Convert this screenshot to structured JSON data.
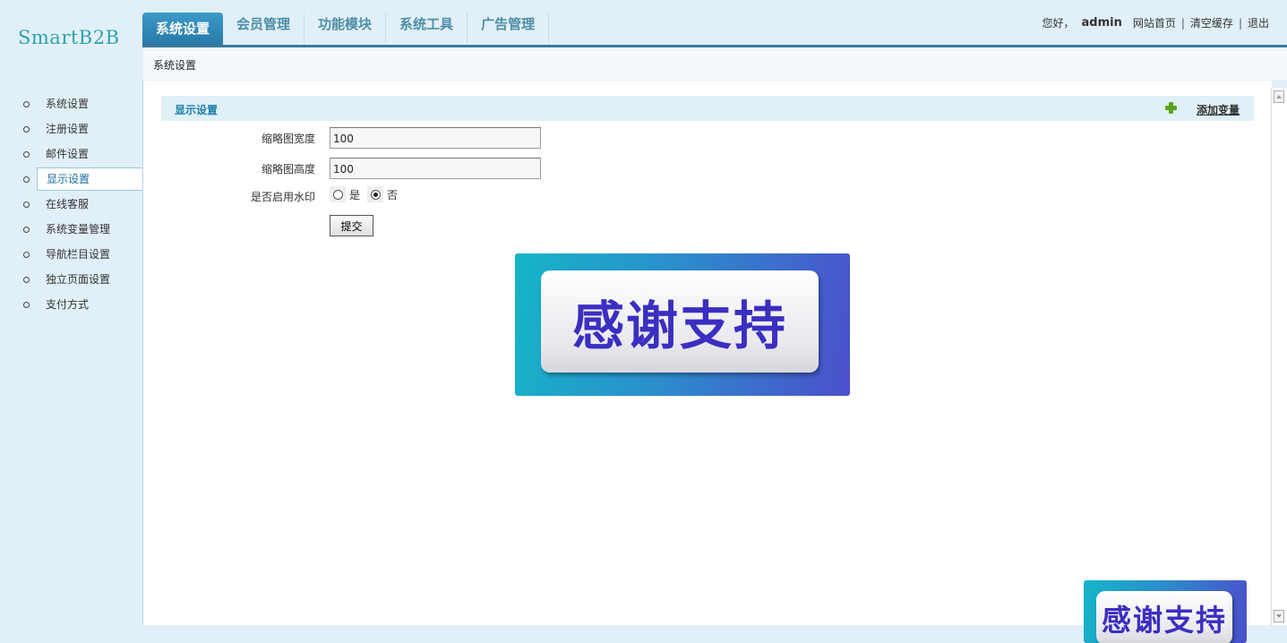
{
  "logo": "SmartB2B",
  "topnav": {
    "tabs": [
      {
        "label": "系统设置",
        "active": true
      },
      {
        "label": "会员管理",
        "active": false
      },
      {
        "label": "功能模块",
        "active": false
      },
      {
        "label": "系统工具",
        "active": false
      },
      {
        "label": "广告管理",
        "active": false
      }
    ]
  },
  "userbar": {
    "greeting": "您好，",
    "username": "admin",
    "links": [
      "网站首页",
      "清空缓存",
      "退出"
    ],
    "separator": "|"
  },
  "breadcrumb": "系统设置",
  "sidebar": {
    "items": [
      {
        "label": "系统设置",
        "active": false
      },
      {
        "label": "注册设置",
        "active": false
      },
      {
        "label": "邮件设置",
        "active": false
      },
      {
        "label": "显示设置",
        "active": true
      },
      {
        "label": "在线客服",
        "active": false
      },
      {
        "label": "系统变量管理",
        "active": false
      },
      {
        "label": "导航栏目设置",
        "active": false
      },
      {
        "label": "独立页面设置",
        "active": false
      },
      {
        "label": "支付方式",
        "active": false
      }
    ]
  },
  "section": {
    "title": "显示设置",
    "add_label": "添加变量"
  },
  "form": {
    "thumb_width_label": "缩略图宽度",
    "thumb_width_value": "100",
    "thumb_height_label": "缩略图高度",
    "thumb_height_value": "100",
    "watermark_label": "是否启用水印",
    "watermark_options": [
      {
        "label": "是",
        "selected": false
      },
      {
        "label": "否",
        "selected": true
      }
    ],
    "submit_label": "提交"
  },
  "banners": {
    "main_text": "感谢支持",
    "corner_text": "感谢支持"
  },
  "colors": {
    "accent": "#2779a8",
    "background": "#e1f0f8",
    "section_title": "#1f7fa8"
  }
}
